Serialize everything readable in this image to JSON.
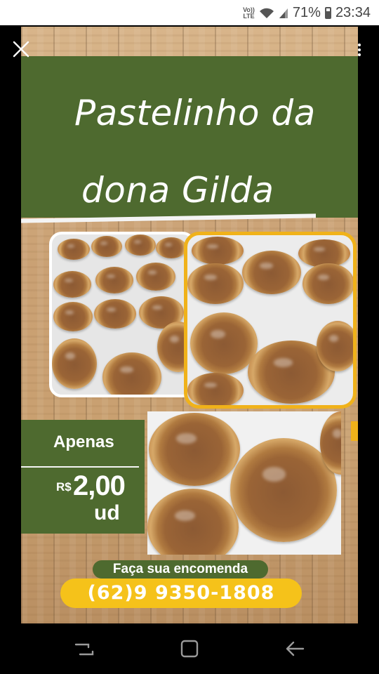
{
  "status_bar": {
    "volte": "Vo)) LTE",
    "battery": "71%",
    "time": "23:34",
    "icons": [
      "volte-icon",
      "wifi-icon",
      "signal-icon",
      "battery-icon"
    ]
  },
  "story": {
    "title_line1": "Pastelinho da",
    "title_line2": "dona Gilda",
    "price": {
      "label": "Apenas",
      "currency": "R$",
      "amount": "2,00",
      "unit": "ud"
    },
    "order_label": "Faça sua encomenda",
    "phone": "(62)9 9350-1808",
    "photos": [
      "tray-of-pastries-photo",
      "pastries-closeup-photo",
      "pastry-macro-photo"
    ]
  },
  "colors": {
    "banner_green": "#4e6a2f",
    "accent_yellow": "#f5c21a",
    "frame_yellow": "#f0b21a",
    "wood": "#caa174"
  },
  "nav_bar": {
    "icons": [
      "recent-apps-icon",
      "home-icon",
      "back-icon"
    ]
  }
}
